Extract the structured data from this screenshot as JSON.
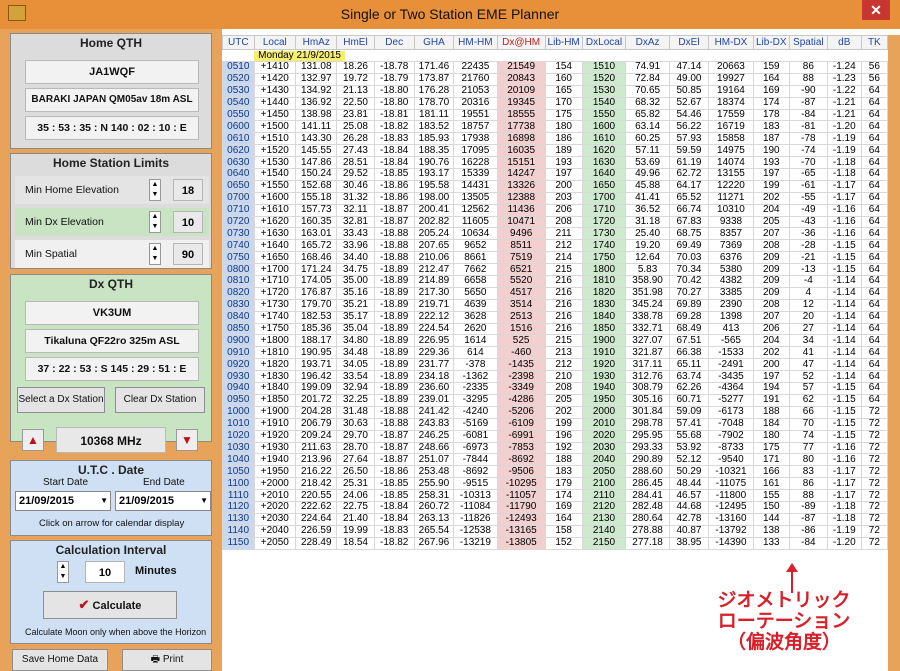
{
  "window": {
    "title": "Single or Two Station EME Planner",
    "close": "✕"
  },
  "home": {
    "title": "Home  QTH",
    "callsign": "JA1WQF",
    "location": "BARAKI JAPAN  QM05av  18m ASL",
    "coords": "35 : 53 : 35 : N  140 : 02 : 10 : E"
  },
  "limits": {
    "title": "Home Station Limits",
    "min_home_elev_label": "Min  Home Elevation",
    "min_home_elev": "18",
    "min_dx_elev_label": "Min  Dx  Elevation",
    "min_dx_elev": "10",
    "min_spatial_label": "Min  Spatial",
    "min_spatial": "90"
  },
  "dx": {
    "title": "Dx  QTH",
    "callsign": "VK3UM",
    "location": "Tikaluna  QF22ro  325m ASL",
    "coords": "37 : 22 : 53 : S  145 : 29 : 51 : E",
    "select_btn": "Select a Dx Station",
    "clear_btn": "Clear Dx Station"
  },
  "freq": {
    "value": "10368 MHz",
    "up": "▲",
    "down": "▼"
  },
  "date": {
    "title": "U.T.C . Date",
    "start_label": "Start Date",
    "end_label": "End Date",
    "start": "21/09/2015",
    "end": "21/09/2015",
    "hint": "Click on arrow for calendar display"
  },
  "interval": {
    "title": "Calculation Interval",
    "value": "10",
    "unit": "Minutes",
    "calc_btn": "Calculate",
    "hint": "Calculate Moon only when above the Horizon"
  },
  "bottom": {
    "save": "Save Home Data",
    "print": "Print"
  },
  "table": {
    "headers": [
      "UTC",
      "Local",
      "HmAz",
      "HmEl",
      "Dec",
      "GHA",
      "HM-HM",
      "Dx@HM",
      "Lib-HM",
      "DxLocal",
      "DxAz",
      "DxEl",
      "HM-DX",
      "Lib-DX",
      "Spatial",
      "dB",
      "TK"
    ],
    "date_label": "Monday 21/9/2015",
    "rows": [
      [
        "0510",
        "+1410",
        "131.08",
        "18.26",
        "-18.78",
        "171.46",
        "22435",
        "21549",
        "154",
        "1510",
        "74.91",
        "47.14",
        "20663",
        "159",
        "86",
        "-1.24",
        "56"
      ],
      [
        "0520",
        "+1420",
        "132.97",
        "19.72",
        "-18.79",
        "173.87",
        "21760",
        "20843",
        "160",
        "1520",
        "72.84",
        "49.00",
        "19927",
        "164",
        "88",
        "-1.23",
        "56"
      ],
      [
        "0530",
        "+1430",
        "134.92",
        "21.13",
        "-18.80",
        "176.28",
        "21053",
        "20109",
        "165",
        "1530",
        "70.65",
        "50.85",
        "19164",
        "169",
        "-90",
        "-1.22",
        "64"
      ],
      [
        "0540",
        "+1440",
        "136.92",
        "22.50",
        "-18.80",
        "178.70",
        "20316",
        "19345",
        "170",
        "1540",
        "68.32",
        "52.67",
        "18374",
        "174",
        "-87",
        "-1.21",
        "64"
      ],
      [
        "0550",
        "+1450",
        "138.98",
        "23.81",
        "-18.81",
        "181.11",
        "19551",
        "18555",
        "175",
        "1550",
        "65.82",
        "54.46",
        "17559",
        "178",
        "-84",
        "-1.21",
        "64"
      ],
      [
        "0600",
        "+1500",
        "141.11",
        "25.08",
        "-18.82",
        "183.52",
        "18757",
        "17738",
        "180",
        "1600",
        "63.14",
        "56.22",
        "16719",
        "183",
        "-81",
        "-1.20",
        "64"
      ],
      [
        "0610",
        "+1510",
        "143.30",
        "26.28",
        "-18.83",
        "185.93",
        "17938",
        "16898",
        "186",
        "1610",
        "60.25",
        "57.93",
        "15858",
        "187",
        "-78",
        "-1.19",
        "64"
      ],
      [
        "0620",
        "+1520",
        "145.55",
        "27.43",
        "-18.84",
        "188.35",
        "17095",
        "16035",
        "189",
        "1620",
        "57.11",
        "59.59",
        "14975",
        "190",
        "-74",
        "-1.19",
        "64"
      ],
      [
        "0630",
        "+1530",
        "147.86",
        "28.51",
        "-18.84",
        "190.76",
        "16228",
        "15151",
        "193",
        "1630",
        "53.69",
        "61.19",
        "14074",
        "193",
        "-70",
        "-1.18",
        "64"
      ],
      [
        "0640",
        "+1540",
        "150.24",
        "29.52",
        "-18.85",
        "193.17",
        "15339",
        "14247",
        "197",
        "1640",
        "49.96",
        "62.72",
        "13155",
        "197",
        "-65",
        "-1.18",
        "64"
      ],
      [
        "0650",
        "+1550",
        "152.68",
        "30.46",
        "-18.86",
        "195.58",
        "14431",
        "13326",
        "200",
        "1650",
        "45.88",
        "64.17",
        "12220",
        "199",
        "-61",
        "-1.17",
        "64"
      ],
      [
        "0700",
        "+1600",
        "155.18",
        "31.32",
        "-18.86",
        "198.00",
        "13505",
        "12388",
        "203",
        "1700",
        "41.41",
        "65.52",
        "11271",
        "202",
        "-55",
        "-1.17",
        "64"
      ],
      [
        "0710",
        "+1610",
        "157.73",
        "32.11",
        "-18.87",
        "200.41",
        "12562",
        "11436",
        "206",
        "1710",
        "36.52",
        "66.74",
        "10310",
        "204",
        "-49",
        "-1.16",
        "64"
      ],
      [
        "0720",
        "+1620",
        "160.35",
        "32.81",
        "-18.87",
        "202.82",
        "11605",
        "10471",
        "208",
        "1720",
        "31.18",
        "67.83",
        "9338",
        "205",
        "-43",
        "-1.16",
        "64"
      ],
      [
        "0730",
        "+1630",
        "163.01",
        "33.43",
        "-18.88",
        "205.24",
        "10634",
        "9496",
        "211",
        "1730",
        "25.40",
        "68.75",
        "8357",
        "207",
        "-36",
        "-1.16",
        "64"
      ],
      [
        "0740",
        "+1640",
        "165.72",
        "33.96",
        "-18.88",
        "207.65",
        "9652",
        "8511",
        "212",
        "1740",
        "19.20",
        "69.49",
        "7369",
        "208",
        "-28",
        "-1.15",
        "64"
      ],
      [
        "0750",
        "+1650",
        "168.46",
        "34.40",
        "-18.88",
        "210.06",
        "8661",
        "7519",
        "214",
        "1750",
        "12.64",
        "70.03",
        "6376",
        "209",
        "-21",
        "-1.15",
        "64"
      ],
      [
        "0800",
        "+1700",
        "171.24",
        "34.75",
        "-18.89",
        "212.47",
        "7662",
        "6521",
        "215",
        "1800",
        "5.83",
        "70.34",
        "5380",
        "209",
        "-13",
        "-1.15",
        "64"
      ],
      [
        "0810",
        "+1710",
        "174.05",
        "35.00",
        "-18.89",
        "214.89",
        "6658",
        "5520",
        "216",
        "1810",
        "358.90",
        "70.42",
        "4382",
        "209",
        "-4",
        "-1.14",
        "64"
      ],
      [
        "0820",
        "+1720",
        "176.87",
        "35.16",
        "-18.89",
        "217.30",
        "5650",
        "4517",
        "216",
        "1820",
        "351.98",
        "70.27",
        "3385",
        "209",
        "4",
        "-1.14",
        "64"
      ],
      [
        "0830",
        "+1730",
        "179.70",
        "35.21",
        "-18.89",
        "219.71",
        "4639",
        "3514",
        "216",
        "1830",
        "345.24",
        "69.89",
        "2390",
        "208",
        "12",
        "-1.14",
        "64"
      ],
      [
        "0840",
        "+1740",
        "182.53",
        "35.17",
        "-18.89",
        "222.12",
        "3628",
        "2513",
        "216",
        "1840",
        "338.78",
        "69.28",
        "1398",
        "207",
        "20",
        "-1.14",
        "64"
      ],
      [
        "0850",
        "+1750",
        "185.36",
        "35.04",
        "-18.89",
        "224.54",
        "2620",
        "1516",
        "216",
        "1850",
        "332.71",
        "68.49",
        "413",
        "206",
        "27",
        "-1.14",
        "64"
      ],
      [
        "0900",
        "+1800",
        "188.17",
        "34.80",
        "-18.89",
        "226.95",
        "1614",
        "525",
        "215",
        "1900",
        "327.07",
        "67.51",
        "-565",
        "204",
        "34",
        "-1.14",
        "64"
      ],
      [
        "0910",
        "+1810",
        "190.95",
        "34.48",
        "-18.89",
        "229.36",
        "614",
        "-460",
        "213",
        "1910",
        "321.87",
        "66.38",
        "-1533",
        "202",
        "41",
        "-1.14",
        "64"
      ],
      [
        "0920",
        "+1820",
        "193.71",
        "34.05",
        "-18.89",
        "231.77",
        "-378",
        "-1435",
        "212",
        "1920",
        "317.11",
        "65.11",
        "-2491",
        "200",
        "47",
        "-1.14",
        "64"
      ],
      [
        "0930",
        "+1830",
        "196.42",
        "33.54",
        "-18.89",
        "234.18",
        "-1362",
        "-2398",
        "210",
        "1930",
        "312.76",
        "63.74",
        "-3435",
        "197",
        "52",
        "-1.14",
        "64"
      ],
      [
        "0940",
        "+1840",
        "199.09",
        "32.94",
        "-18.89",
        "236.60",
        "-2335",
        "-3349",
        "208",
        "1940",
        "308.79",
        "62.26",
        "-4364",
        "194",
        "57",
        "-1.15",
        "64"
      ],
      [
        "0950",
        "+1850",
        "201.72",
        "32.25",
        "-18.89",
        "239.01",
        "-3295",
        "-4286",
        "205",
        "1950",
        "305.16",
        "60.71",
        "-5277",
        "191",
        "62",
        "-1.15",
        "64"
      ],
      [
        "1000",
        "+1900",
        "204.28",
        "31.48",
        "-18.88",
        "241.42",
        "-4240",
        "-5206",
        "202",
        "2000",
        "301.84",
        "59.09",
        "-6173",
        "188",
        "66",
        "-1.15",
        "72"
      ],
      [
        "1010",
        "+1910",
        "206.79",
        "30.63",
        "-18.88",
        "243.83",
        "-5169",
        "-6109",
        "199",
        "2010",
        "298.78",
        "57.41",
        "-7048",
        "184",
        "70",
        "-1.15",
        "72"
      ],
      [
        "1020",
        "+1920",
        "209.24",
        "29.70",
        "-18.87",
        "246.25",
        "-6081",
        "-6991",
        "196",
        "2020",
        "295.95",
        "55.68",
        "-7902",
        "180",
        "74",
        "-1.15",
        "72"
      ],
      [
        "1030",
        "+1930",
        "211.63",
        "28.70",
        "-18.87",
        "248.66",
        "-6973",
        "-7853",
        "192",
        "2030",
        "293.33",
        "53.92",
        "-8733",
        "175",
        "77",
        "-1.16",
        "72"
      ],
      [
        "1040",
        "+1940",
        "213.96",
        "27.64",
        "-18.87",
        "251.07",
        "-7844",
        "-8692",
        "188",
        "2040",
        "290.89",
        "52.12",
        "-9540",
        "171",
        "80",
        "-1.16",
        "72"
      ],
      [
        "1050",
        "+1950",
        "216.22",
        "26.50",
        "-18.86",
        "253.48",
        "-8692",
        "-9506",
        "183",
        "2050",
        "288.60",
        "50.29",
        "-10321",
        "166",
        "83",
        "-1.17",
        "72"
      ],
      [
        "1100",
        "+2000",
        "218.42",
        "25.31",
        "-18.85",
        "255.90",
        "-9515",
        "-10295",
        "179",
        "2100",
        "286.45",
        "48.44",
        "-11075",
        "161",
        "86",
        "-1.17",
        "72"
      ],
      [
        "1110",
        "+2010",
        "220.55",
        "24.06",
        "-18.85",
        "258.31",
        "-10313",
        "-11057",
        "174",
        "2110",
        "284.41",
        "46.57",
        "-11800",
        "155",
        "88",
        "-1.17",
        "72"
      ],
      [
        "1120",
        "+2020",
        "222.62",
        "22.75",
        "-18.84",
        "260.72",
        "-11084",
        "-11790",
        "169",
        "2120",
        "282.48",
        "44.68",
        "-12495",
        "150",
        "-89",
        "-1.18",
        "72"
      ],
      [
        "1130",
        "+2030",
        "224.64",
        "21.40",
        "-18.84",
        "263.13",
        "-11826",
        "-12493",
        "164",
        "2130",
        "280.64",
        "42.78",
        "-13160",
        "144",
        "-87",
        "-1.18",
        "72"
      ],
      [
        "1140",
        "+2040",
        "226.59",
        "19.99",
        "-18.83",
        "265.54",
        "-12538",
        "-13165",
        "158",
        "2140",
        "278.88",
        "40.87",
        "-13792",
        "138",
        "-86",
        "-1.19",
        "72"
      ],
      [
        "1150",
        "+2050",
        "228.49",
        "18.54",
        "-18.82",
        "267.96",
        "-13219",
        "-13805",
        "152",
        "2150",
        "277.18",
        "38.95",
        "-14390",
        "133",
        "-84",
        "-1.20",
        "72"
      ]
    ]
  },
  "annotation": {
    "lines": [
      "ジオメトリック",
      "ローテーション",
      "（偏波角度）"
    ]
  },
  "colors": {
    "titlebar": "#e88f3a",
    "panel_bg": "#e8a35a",
    "panel_green": "#c9e4c3",
    "panel_blue": "#cfe0f5",
    "utc_col": "#c8d8f0",
    "dxhm_col": "#f3d0d0",
    "dxlocal_col": "#cfe9cf",
    "annotation": "#d8202a",
    "date_badge": "#f6ee6c"
  }
}
